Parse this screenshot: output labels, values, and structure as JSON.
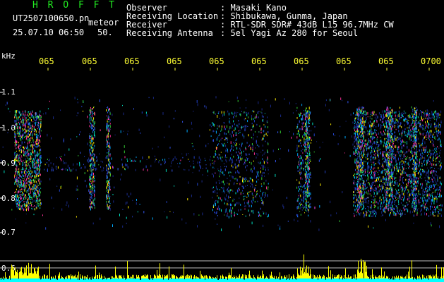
{
  "header": {
    "title": "H R O F F T",
    "file": "UT2507100650.pn",
    "meteor_label": "meteor",
    "datetime": "25.07.10 06:50",
    "count": "50.",
    "observer_label": "Observer",
    "observer": ": Masaki Kano",
    "location_label": "Receiving Location",
    "location": ": Shibukawa, Gunma, Japan",
    "receiver_label": "Receiver",
    "receiver": ": RTL-SDR SDR# 43dB L15 96.7MHz CW",
    "antenna_label": "Receiving Antenna",
    "antenna": ": 5el Yagi Az 280 for Seoul"
  },
  "axis": {
    "unit": "kHz",
    "y_ticks": [
      "1.1",
      "1.0",
      "0.9",
      "0.8",
      "0.7",
      "0.6"
    ],
    "x_ticks": [
      "065",
      "065",
      "065",
      "065",
      "065",
      "065",
      "065",
      "065",
      "065",
      "0700"
    ]
  },
  "colors": {
    "background": "#000000",
    "header_text": "#ffffff",
    "title": "#22ee22",
    "time_ticks": "#ffff33",
    "level_yellow": "#ffff00",
    "level_cyan": "#00ffff"
  }
}
